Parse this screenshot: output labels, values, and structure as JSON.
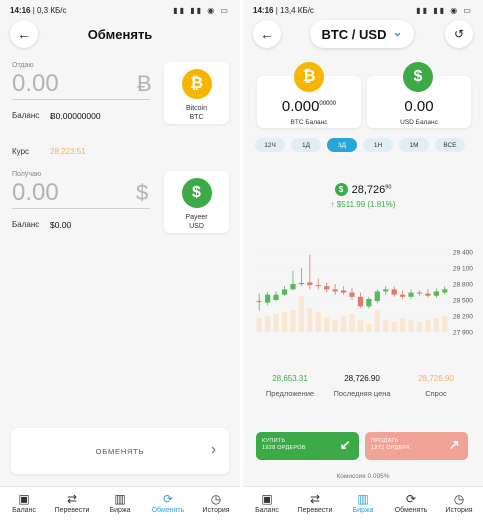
{
  "left": {
    "status": {
      "time": "14:16",
      "net": "0,3 КБ/с",
      "icons": "▮▮ ▮▮ ◉ ▭"
    },
    "header": {
      "title": "Обменять",
      "back_icon": "arrow-left-icon"
    },
    "give": {
      "label": "Отдаю",
      "value": "0.00",
      "symbol": "Ƀ"
    },
    "give_balance": {
      "label": "Баланс",
      "value": "Ƀ0.00000000"
    },
    "rate": {
      "label": "Курс",
      "value": "28,223.51",
      "color": "#f3b06b"
    },
    "receive": {
      "label": "Получаю",
      "value": "0.00",
      "symbol": "$"
    },
    "receive_balance": {
      "label": "Баланс",
      "value": "$0.00"
    },
    "from_coin": {
      "symbol": "₿",
      "line1": "Bitcoin",
      "line2": "BTC",
      "color": "#f7b500"
    },
    "to_coin": {
      "symbol": "$",
      "line1": "Payeer",
      "line2": "USD",
      "color": "#3daa48"
    },
    "exchange_button": {
      "label": "ОБМЕНЯТЬ",
      "chevron": "›"
    },
    "nav": [
      {
        "label": "Баланс",
        "icon": "▣",
        "active": false
      },
      {
        "label": "Перевести",
        "icon": "⇄",
        "active": false
      },
      {
        "label": "Биржа",
        "icon": "▥",
        "active": false
      },
      {
        "label": "Обменять",
        "icon": "⟳",
        "active": true
      },
      {
        "label": "История",
        "icon": "◷",
        "active": false
      }
    ]
  },
  "right": {
    "status": {
      "time": "14:16",
      "net": "13,4 КБ/с",
      "icons": "▮▮ ▮▮ ◉ ▭"
    },
    "header": {
      "pair": "BTC / USD",
      "dropdown": "⌄",
      "back_icon": "arrow-left-icon",
      "history_icon": "history-icon"
    },
    "btc_balance": {
      "value": "0.000",
      "small": "00000",
      "label": "BTC Баланс",
      "symbol": "₿",
      "color": "#f7b500"
    },
    "usd_balance": {
      "value": "0.00",
      "label": "USD Баланс",
      "symbol": "$",
      "color": "#3daa48"
    },
    "timeframes": [
      {
        "label": "12Ч",
        "active": false
      },
      {
        "label": "1Д",
        "active": false
      },
      {
        "label": "3Д",
        "active": true
      },
      {
        "label": "1Н",
        "active": false
      },
      {
        "label": "1М",
        "active": false
      },
      {
        "label": "ВСЕ",
        "active": false
      }
    ],
    "price": {
      "value": "28,726",
      "small": "90",
      "symbol": "$",
      "change": "↑ $511.99 (1.81%)"
    },
    "chart_data": {
      "type": "candlestick",
      "y_ticks": [
        "29 400",
        "29 100",
        "28 800",
        "28 500",
        "28 200",
        "27 900"
      ],
      "ylim": [
        27900,
        29400
      ],
      "up_color": "#5cb85c",
      "down_color": "#e07b6a",
      "candles": [
        {
          "o": 28480,
          "c": 28480,
          "h": 28620,
          "l": 28300
        },
        {
          "o": 28450,
          "c": 28600,
          "h": 28650,
          "l": 28400
        },
        {
          "o": 28500,
          "c": 28600,
          "h": 28660,
          "l": 28480
        },
        {
          "o": 28600,
          "c": 28700,
          "h": 28760,
          "l": 28580
        },
        {
          "o": 28700,
          "c": 28800,
          "h": 29050,
          "l": 28680
        },
        {
          "o": 28800,
          "c": 28820,
          "h": 29100,
          "l": 28760
        },
        {
          "o": 28830,
          "c": 28780,
          "h": 29350,
          "l": 28700
        },
        {
          "o": 28780,
          "c": 28760,
          "h": 28900,
          "l": 28700
        },
        {
          "o": 28760,
          "c": 28700,
          "h": 28820,
          "l": 28650
        },
        {
          "o": 28700,
          "c": 28660,
          "h": 28800,
          "l": 28600
        },
        {
          "o": 28680,
          "c": 28640,
          "h": 28760,
          "l": 28600
        },
        {
          "o": 28640,
          "c": 28560,
          "h": 28720,
          "l": 28500
        },
        {
          "o": 28560,
          "c": 28380,
          "h": 28640,
          "l": 28350
        },
        {
          "o": 28380,
          "c": 28520,
          "h": 28560,
          "l": 28340
        },
        {
          "o": 28480,
          "c": 28660,
          "h": 28700,
          "l": 28440
        },
        {
          "o": 28660,
          "c": 28700,
          "h": 28760,
          "l": 28600
        },
        {
          "o": 28700,
          "c": 28600,
          "h": 28760,
          "l": 28560
        },
        {
          "o": 28600,
          "c": 28560,
          "h": 28680,
          "l": 28520
        },
        {
          "o": 28560,
          "c": 28640,
          "h": 28700,
          "l": 28520
        },
        {
          "o": 28640,
          "c": 28620,
          "h": 28680,
          "l": 28580
        },
        {
          "o": 28620,
          "c": 28580,
          "h": 28700,
          "l": 28540
        },
        {
          "o": 28580,
          "c": 28660,
          "h": 28720,
          "l": 28540
        },
        {
          "o": 28640,
          "c": 28700,
          "h": 28760,
          "l": 28600
        }
      ],
      "volumes": [
        0.35,
        0.4,
        0.45,
        0.5,
        0.55,
        0.9,
        0.6,
        0.5,
        0.35,
        0.3,
        0.4,
        0.45,
        0.3,
        0.2,
        0.55,
        0.3,
        0.25,
        0.35,
        0.3,
        0.25,
        0.3,
        0.35,
        0.4
      ]
    },
    "quotes": [
      {
        "value": "28,653.31",
        "label": "Предложение",
        "color": "#3daa48"
      },
      {
        "value": "28,726.90",
        "label": "Последняя цена",
        "color": "#111111"
      },
      {
        "value": "28,726.90",
        "label": "Спрос",
        "color": "#f3b06b"
      }
    ],
    "buy": {
      "line1": "КУПИТЬ",
      "line2": "1928 ОРДЕРОВ",
      "color": "#3daa48"
    },
    "sell": {
      "line1": "ПРОДАТЬ",
      "line2": "1272 ОРДЕРА",
      "color": "#f0a396"
    },
    "commission": "Комиссия 0.095%",
    "nav": [
      {
        "label": "Баланс",
        "icon": "▣",
        "active": false
      },
      {
        "label": "Перевести",
        "icon": "⇄",
        "active": false
      },
      {
        "label": "Биржа",
        "icon": "▥",
        "active": true
      },
      {
        "label": "Обменять",
        "icon": "⟳",
        "active": false
      },
      {
        "label": "История",
        "icon": "◷",
        "active": false
      }
    ]
  }
}
